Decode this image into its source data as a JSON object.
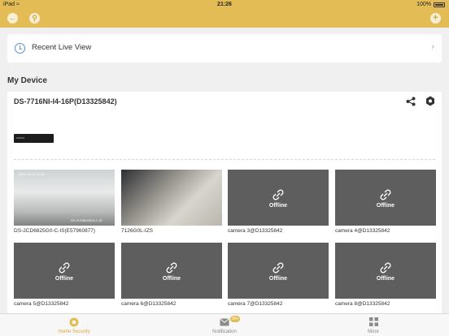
{
  "status_bar": {
    "device": "iPad",
    "time": "21:26",
    "battery": "100%"
  },
  "header": {
    "left_icons": [
      "back-icon",
      "search-icon"
    ],
    "right_icon": "add-icon"
  },
  "recent": {
    "label": "Recent Live View"
  },
  "section_title": "My Device",
  "device": {
    "name": "DS-7716NI-I4-16P(D13325842)"
  },
  "cameras": [
    {
      "name": "DS-2CD6825G0-C-IS(E57960877)",
      "status": "",
      "snapshot_text": [
        "2019-10-14 21:25",
        "DS-2CD6825G0-C-IS"
      ]
    },
    {
      "name": "7126G0L-IZS",
      "status": ""
    },
    {
      "name": "camera 3@D13325842",
      "status": "Offline"
    },
    {
      "name": "camera 4@D13325842",
      "status": "Offline"
    },
    {
      "name": "camera 5@D13325842",
      "status": "Offline"
    },
    {
      "name": "camera 6@D13325842",
      "status": "Offline"
    },
    {
      "name": "camera 7@D13325842",
      "status": "Offline"
    },
    {
      "name": "camera 8@D13325842",
      "status": "Offline"
    }
  ],
  "tabs": [
    {
      "label": "Home Security",
      "icon": "home-security-icon",
      "active": true
    },
    {
      "label": "Notification",
      "icon": "mail-icon",
      "badge": "99+"
    },
    {
      "label": "More",
      "icon": "grid-icon"
    }
  ],
  "colors": {
    "accent": "#e3bc55",
    "tile": "#5e5e5e",
    "link": "#5a8fd6"
  }
}
